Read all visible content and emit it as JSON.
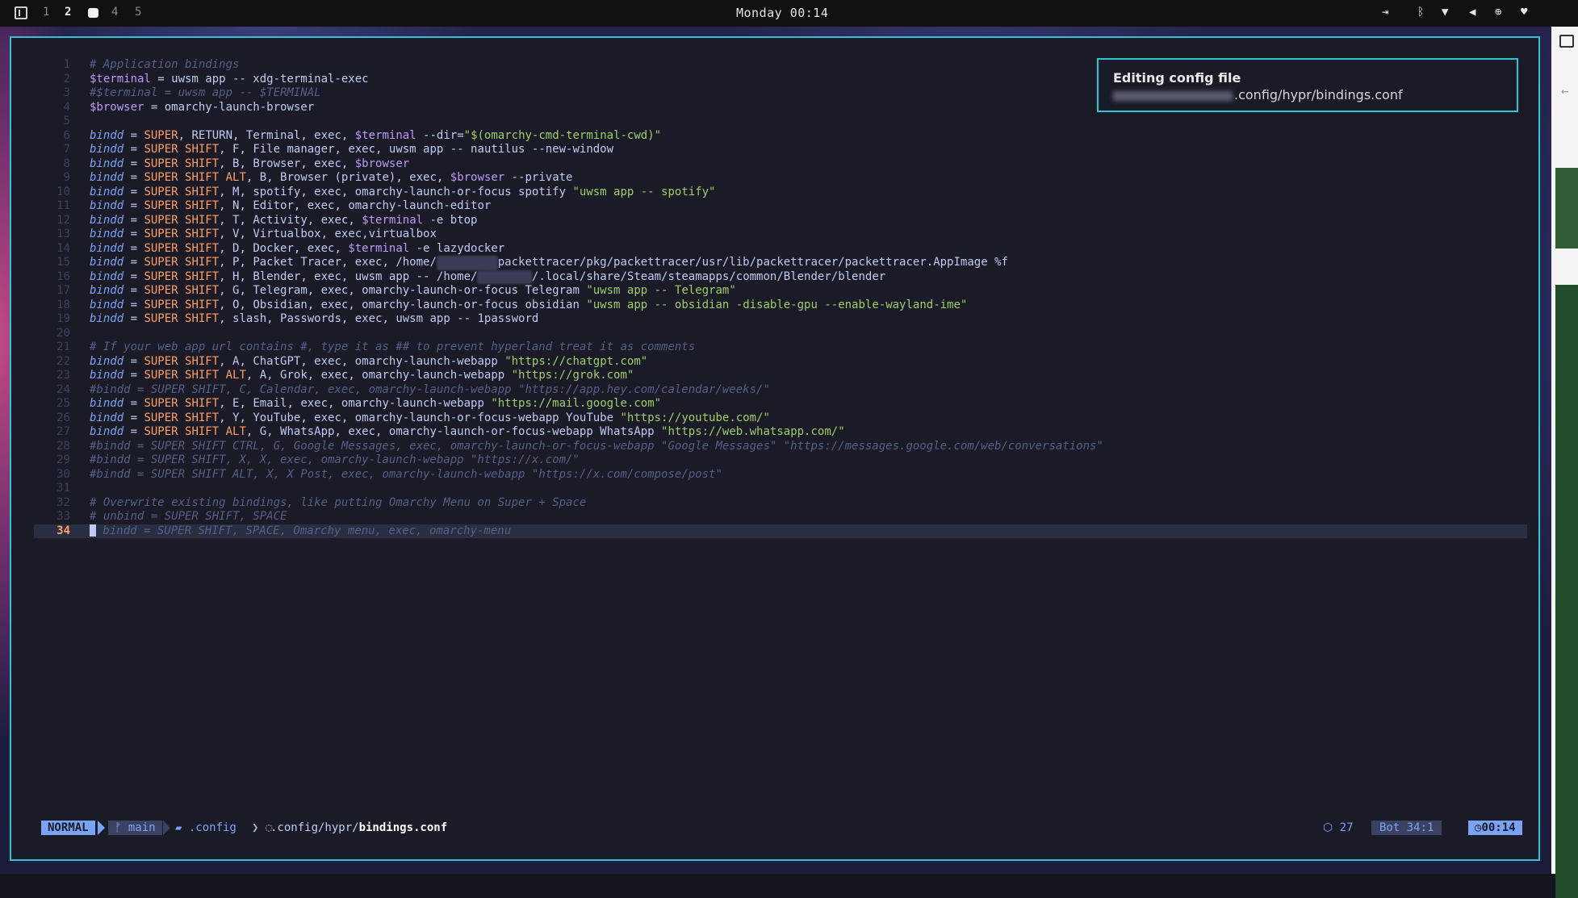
{
  "topbar": {
    "workspaces": [
      "1",
      "2",
      "4",
      "5"
    ],
    "active_workspace": "2",
    "clock": "Monday 00:14"
  },
  "notification": {
    "title": "Editing config file",
    "path_suffix": ".config/hypr/bindings.conf"
  },
  "editor": {
    "lines": [
      "# Application bindings",
      "$terminal = uwsm app -- xdg-terminal-exec",
      "#$terminal = uwsm app -- $TERMINAL",
      "$browser = omarchy-launch-browser",
      "",
      "bindd = SUPER, RETURN, Terminal, exec, $terminal --dir=\"$(omarchy-cmd-terminal-cwd)\"",
      "bindd = SUPER SHIFT, F, File manager, exec, uwsm app -- nautilus --new-window",
      "bindd = SUPER SHIFT, B, Browser, exec, $browser",
      "bindd = SUPER SHIFT ALT, B, Browser (private), exec, $browser --private",
      "bindd = SUPER SHIFT, M, spotify, exec, omarchy-launch-or-focus spotify \"uwsm app -- spotify\"",
      "bindd = SUPER SHIFT, N, Editor, exec, omarchy-launch-editor",
      "bindd = SUPER SHIFT, T, Activity, exec, $terminal -e btop",
      "bindd = SUPER SHIFT, V, Virtualbox, exec,virtualbox",
      "bindd = SUPER SHIFT, D, Docker, exec, $terminal -e lazydocker",
      "bindd = SUPER SHIFT, P, Packet Tracer, exec, /home/packettracer/pkg/packettracer/usr/lib/packettracer/packettracer.AppImage %f",
      "bindd = SUPER SHIFT, H, Blender, exec, uwsm app -- /home//.local/share/Steam/steamapps/common/Blender/blender",
      "bindd = SUPER SHIFT, G, Telegram, exec, omarchy-launch-or-focus Telegram \"uwsm app -- Telegram\"",
      "bindd = SUPER SHIFT, O, Obsidian, exec, omarchy-launch-or-focus obsidian \"uwsm app -- obsidian -disable-gpu --enable-wayland-ime\"",
      "bindd = SUPER SHIFT, slash, Passwords, exec, uwsm app -- 1password",
      "",
      "# If your web app url contains #, type it as ## to prevent hyperland treat it as comments",
      "bindd = SUPER SHIFT, A, ChatGPT, exec, omarchy-launch-webapp \"https://chatgpt.com\"",
      "bindd = SUPER SHIFT ALT, A, Grok, exec, omarchy-launch-webapp \"https://grok.com\"",
      "#bindd = SUPER SHIFT, C, Calendar, exec, omarchy-launch-webapp \"https://app.hey.com/calendar/weeks/\"",
      "bindd = SUPER SHIFT, E, Email, exec, omarchy-launch-webapp \"https://mail.google.com\"",
      "bindd = SUPER SHIFT, Y, YouTube, exec, omarchy-launch-or-focus-webapp YouTube \"https://youtube.com/\"",
      "bindd = SUPER SHIFT ALT, G, WhatsApp, exec, omarchy-launch-or-focus-webapp WhatsApp \"https://web.whatsapp.com/\"",
      "#bindd = SUPER SHIFT CTRL, G, Google Messages, exec, omarchy-launch-or-focus-webapp \"Google Messages\" \"https://messages.google.com/web/conversations\"",
      "#bindd = SUPER SHIFT, X, X, exec, omarchy-launch-webapp \"https://x.com/\"",
      "#bindd = SUPER SHIFT ALT, X, X Post, exec, omarchy-launch-webapp \"https://x.com/compose/post\"",
      "",
      "# Overwrite existing bindings, like putting Omarchy Menu on Super + Space",
      "# unbind = SUPER SHIFT, SPACE",
      "# bindd = SUPER SHIFT, SPACE, Omarchy menu, exec, omarchy-menu"
    ],
    "current_line": 34
  },
  "statusline": {
    "mode": "NORMAL",
    "branch": "main",
    "directory": ".config",
    "file_path": ".config/hypr/",
    "file_name": "bindings.conf",
    "diagnostics": "27",
    "scroll": "Bot",
    "position": "34:1",
    "time": "00:14"
  }
}
